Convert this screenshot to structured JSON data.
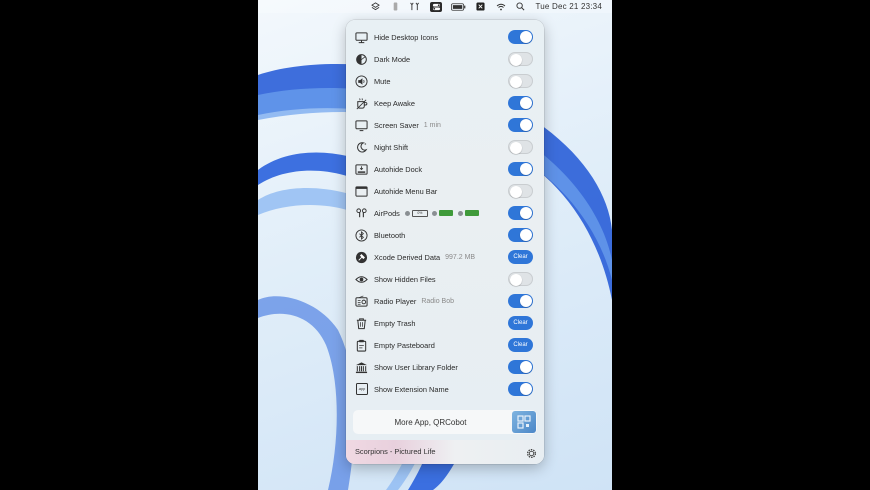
{
  "menubar": {
    "icons": [
      "layers-icon",
      "phone-icon",
      "antenna-icon",
      "toggles-icon",
      "battery-icon",
      "app-icon",
      "wifi-icon",
      "search-icon"
    ],
    "clock": "Tue Dec 21  23:34"
  },
  "rows": [
    {
      "label": "Hide Desktop Icons",
      "icon": "display-icon",
      "control": "toggle",
      "state": "on"
    },
    {
      "label": "Dark Mode",
      "icon": "dark-mode-icon",
      "control": "toggle",
      "state": "off"
    },
    {
      "label": "Mute",
      "icon": "speaker-icon",
      "control": "toggle",
      "state": "off"
    },
    {
      "label": "Keep Awake",
      "icon": "coffee-icon",
      "control": "toggle",
      "state": "on"
    },
    {
      "label": "Screen Saver",
      "detail": "1 min",
      "icon": "monitor-icon",
      "control": "toggle",
      "state": "on"
    },
    {
      "label": "Night Shift",
      "icon": "moon-icon",
      "control": "toggle",
      "state": "off"
    },
    {
      "label": "Autohide Dock",
      "icon": "dock-icon",
      "control": "toggle",
      "state": "on"
    },
    {
      "label": "Autohide Menu Bar",
      "icon": "menubar-icon",
      "control": "toggle",
      "state": "off"
    },
    {
      "label": "AirPods",
      "icon": "airpods-icon",
      "control": "toggle",
      "state": "on",
      "case_label": "0%"
    },
    {
      "label": "Bluetooth",
      "icon": "bluetooth-icon",
      "control": "toggle",
      "state": "on"
    },
    {
      "label": "Xcode Derived Data",
      "detail": "997.2 MB",
      "icon": "hammer-icon",
      "control": "button",
      "button_label": "Clear"
    },
    {
      "label": "Show Hidden Files",
      "icon": "eye-icon",
      "control": "toggle",
      "state": "off"
    },
    {
      "label": "Radio Player",
      "detail": "Radio Bob",
      "icon": "radio-icon",
      "control": "toggle",
      "state": "on"
    },
    {
      "label": "Empty Trash",
      "icon": "trash-icon",
      "control": "button",
      "button_label": "Clear"
    },
    {
      "label": "Empty Pasteboard",
      "icon": "clipboard-icon",
      "control": "button",
      "button_label": "Clear"
    },
    {
      "label": "Show User Library Folder",
      "icon": "library-icon",
      "control": "toggle",
      "state": "on"
    },
    {
      "label": "Show Extension Name",
      "icon": "extension-icon",
      "control": "toggle",
      "state": "on",
      "icon_text": ".app"
    }
  ],
  "more_app": {
    "label": "More App, QRCobot"
  },
  "now_playing": {
    "text": "Scorpions - Pictured Life"
  },
  "colors": {
    "accent": "#2f76d8",
    "toggle_off": "#dfe3e6",
    "airpods_battery": "#3f9a3a"
  }
}
